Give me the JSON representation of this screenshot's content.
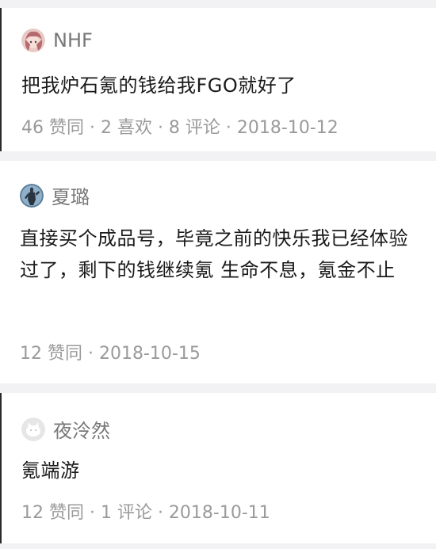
{
  "comments": [
    {
      "author": "NHF",
      "avatar": "anime-avatar-pink",
      "text": "把我炉石氪的钱给我FGO就好了",
      "meta": "46 赞同 · 2 喜欢 · 8 评论 · 2018-10-12"
    },
    {
      "author": "夏璐",
      "avatar": "character-avatar-blue",
      "text": "直接买个成品号，毕竟之前的快乐我已经体验过了，剩下的钱继续氪 生命不息，氪金不止",
      "meta": "12 赞同 · 2018-10-15"
    },
    {
      "author": "夜泠然",
      "avatar": "default-avatar-gray",
      "text": "氪端游",
      "meta": "12 赞同 · 1 评论 · 2018-10-11"
    }
  ]
}
